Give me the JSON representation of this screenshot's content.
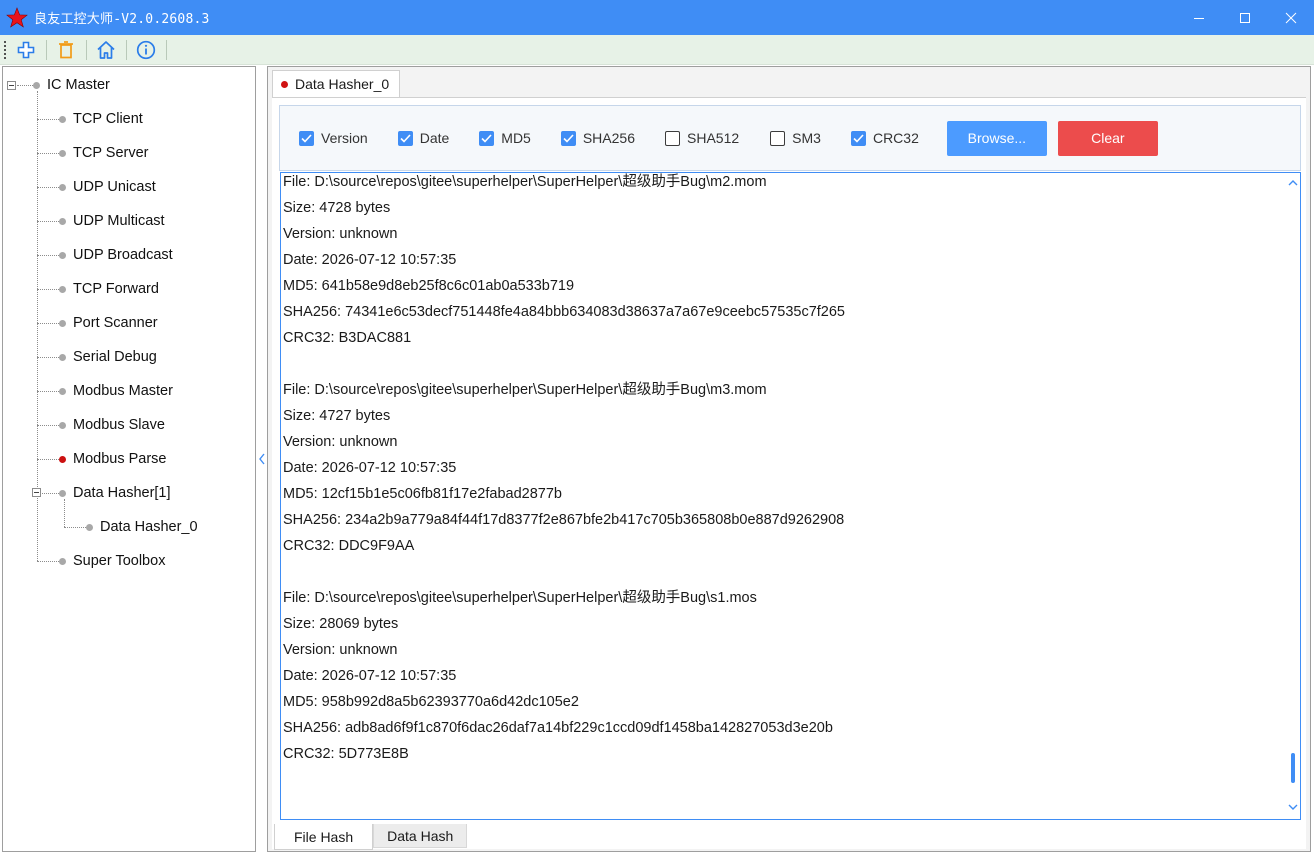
{
  "window": {
    "title": "良友工控大师-V2.0.2608.3",
    "accent": "#3f8df5"
  },
  "toolbar": {
    "icons": [
      "add-icon",
      "delete-icon",
      "home-icon",
      "info-icon"
    ]
  },
  "tree": {
    "root": "IC Master",
    "items": [
      {
        "label": "TCP Client"
      },
      {
        "label": "TCP Server"
      },
      {
        "label": "UDP Unicast"
      },
      {
        "label": "UDP Multicast"
      },
      {
        "label": "UDP Broadcast"
      },
      {
        "label": "TCP Forward"
      },
      {
        "label": "Port Scanner"
      },
      {
        "label": "Serial Debug"
      },
      {
        "label": "Modbus Master"
      },
      {
        "label": "Modbus Slave"
      },
      {
        "label": "Modbus Parse"
      },
      {
        "label": "Data Hasher[1]"
      },
      {
        "label": "Data Hasher_0"
      },
      {
        "label": "Super Toolbox"
      }
    ]
  },
  "document_tab": {
    "label": "Data Hasher_0"
  },
  "options": [
    {
      "label": "Version",
      "checked": true
    },
    {
      "label": "Date",
      "checked": true
    },
    {
      "label": "MD5",
      "checked": true
    },
    {
      "label": "SHA256",
      "checked": true
    },
    {
      "label": "SHA512",
      "checked": false
    },
    {
      "label": "SM3",
      "checked": false
    },
    {
      "label": "CRC32",
      "checked": true
    }
  ],
  "buttons": {
    "browse": "Browse...",
    "clear": "Clear"
  },
  "output": {
    "lines": [
      "File: D:\\source\\repos\\gitee\\superhelper\\SuperHelper\\超级助手Bug\\m2.mom",
      "Size: 4728 bytes",
      "Version: unknown",
      "Date: 2026-07-12 10:57:35",
      "MD5: 641b58e9d8eb25f8c6c01ab0a533b719",
      "SHA256: 74341e6c53decf751448fe4a84bbb634083d38637a7a67e9ceebc57535c7f265",
      "CRC32: B3DAC881",
      "",
      "File: D:\\source\\repos\\gitee\\superhelper\\SuperHelper\\超级助手Bug\\m3.mom",
      "Size: 4727 bytes",
      "Version: unknown",
      "Date: 2026-07-12 10:57:35",
      "MD5: 12cf15b1e5c06fb81f17e2fabad2877b",
      "SHA256: 234a2b9a779a84f44f17d8377f2e867bfe2b417c705b365808b0e887d9262908",
      "CRC32: DDC9F9AA",
      "",
      "File: D:\\source\\repos\\gitee\\superhelper\\SuperHelper\\超级助手Bug\\s1.mos",
      "Size: 28069 bytes",
      "Version: unknown",
      "Date: 2026-07-12 10:57:35",
      "MD5: 958b992d8a5b62393770a6d42dc105e2",
      "SHA256: adb8ad6f9f1c870f6dac26daf7a14bf229c1ccd09df1458ba142827053d3e20b",
      "CRC32: 5D773E8B"
    ]
  },
  "bottom_tabs": [
    {
      "label": "File Hash",
      "active": true
    },
    {
      "label": "Data Hash",
      "active": false
    }
  ]
}
